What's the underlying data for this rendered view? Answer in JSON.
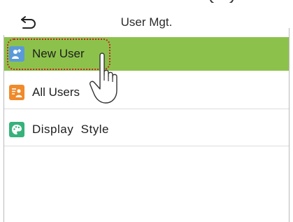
{
  "header": {
    "title": "User Mgt.",
    "back_icon": "back-arrow-icon"
  },
  "menu": {
    "items": [
      {
        "label": "New User",
        "icon": "add-user-icon",
        "selected": true
      },
      {
        "label": "All Users",
        "icon": "users-list-icon",
        "selected": false
      },
      {
        "label": "Display  Style",
        "icon": "palette-icon",
        "selected": false
      }
    ]
  },
  "colors": {
    "selected_bg": "#8cc24b",
    "highlight_ring": "#c62828",
    "new_user_icon": "#5a9ad8",
    "all_users_icon": "#f08a2a",
    "display_style_icon": "#36b27a"
  },
  "overlay": {
    "pointer_icon": "pointing-hand-icon"
  }
}
